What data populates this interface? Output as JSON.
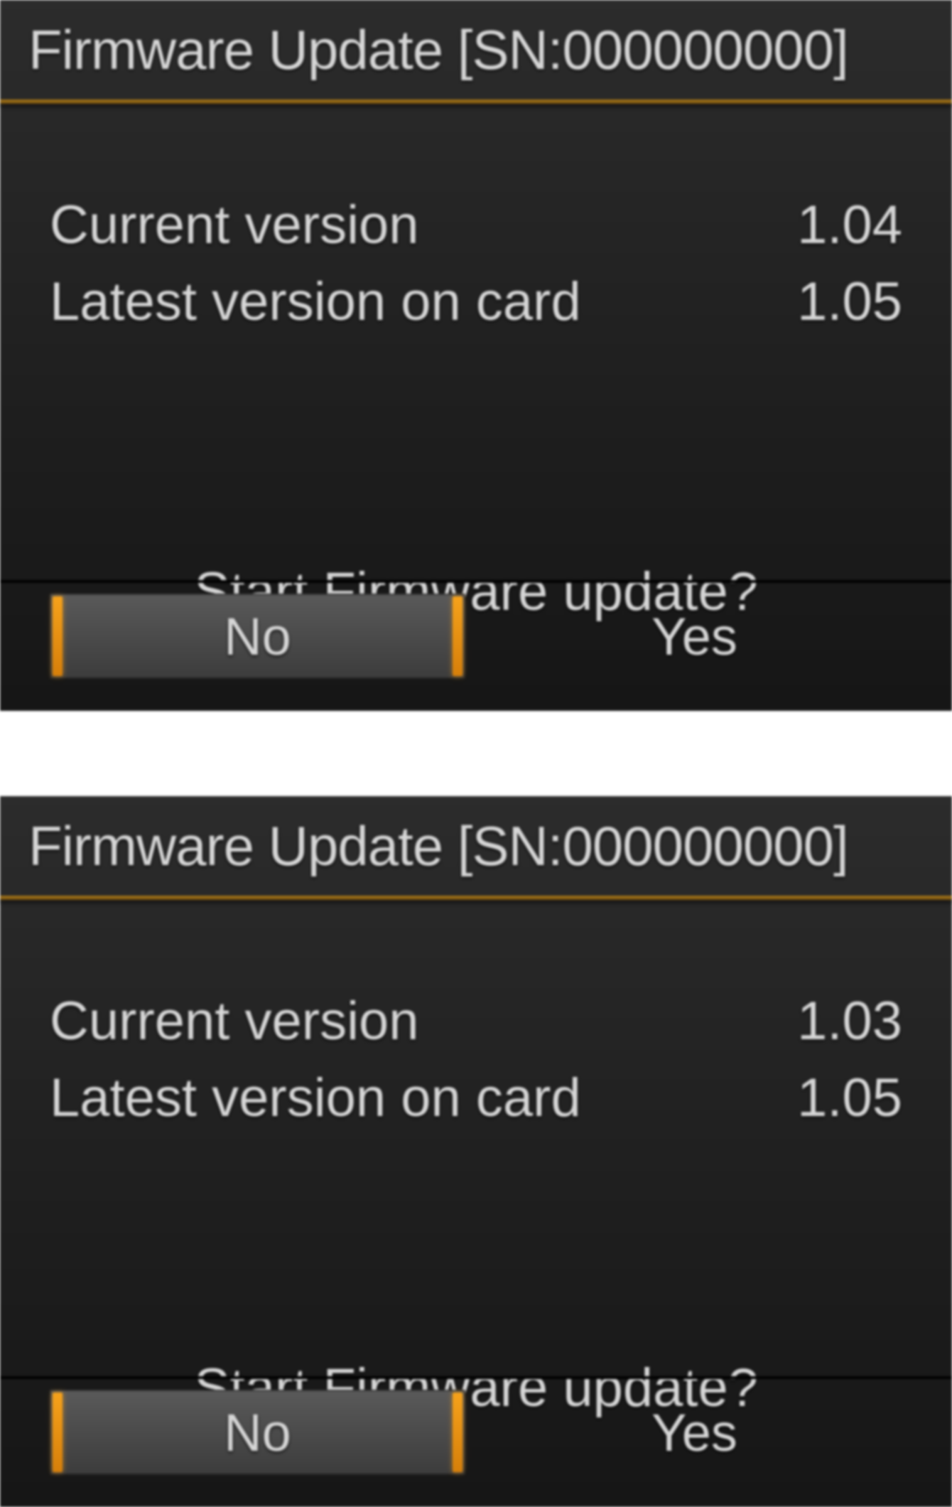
{
  "accent_color": "#f6a21b",
  "panels": [
    {
      "title": "Firmware Update [SN:000000000]",
      "current_label": "Current version",
      "current_value": "1.04",
      "latest_label": "Latest version on card",
      "latest_value": "1.05",
      "prompt": "Start Firmware update?",
      "no_label": "No",
      "yes_label": "Yes",
      "selected": "no"
    },
    {
      "title": "Firmware Update [SN:000000000]",
      "current_label": "Current version",
      "current_value": "1.03",
      "latest_label": "Latest version on card",
      "latest_value": "1.05",
      "prompt": "Start Firmware update?",
      "no_label": "No",
      "yes_label": "Yes",
      "selected": "no"
    }
  ]
}
